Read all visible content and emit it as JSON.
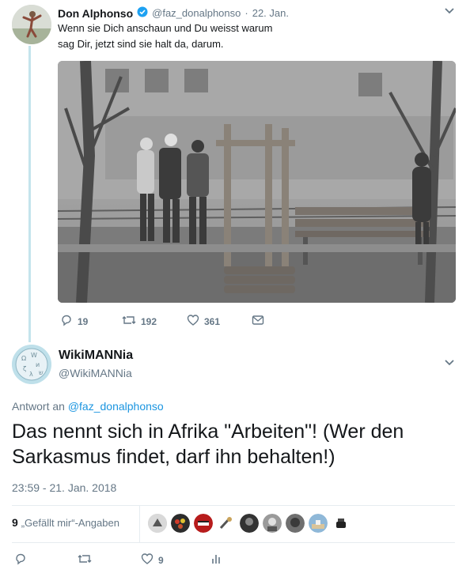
{
  "quoted_tweet": {
    "display_name": "Don Alphonso",
    "handle": "@faz_donalphonso",
    "separator": "·",
    "date": "22. Jan.",
    "text_line1": "Wenn sie Dich anschaun und Du weisst warum",
    "text_line2": "sag Dir, jetzt sind sie halt da, darum.",
    "replies": "19",
    "retweets": "192",
    "likes": "361",
    "verified_color": "#1da1f2"
  },
  "main_tweet": {
    "display_name": "WikiMANNia",
    "handle": "@WikiMANNia",
    "reply_prefix": "Antwort an",
    "reply_to": "@faz_donalphonso",
    "text_line1": "Das nennt sich in Afrika \"Arbeiten\"! (Wer den",
    "text_line2": "Sarkasmus findet, darf ihn behalten!)",
    "timestamp": "23:59 - 21. Jan. 2018",
    "likes_count": "9",
    "likes_label": "„Gefällt mir“-Angaben",
    "action_likes": "9"
  },
  "colors": {
    "link": "#1b95e0",
    "muted": "#657786",
    "thread_line": "#c4e4ec"
  },
  "icons": [
    "reply-icon",
    "retweet-icon",
    "like-icon",
    "message-icon",
    "analytics-icon",
    "chevron-down-icon",
    "verified-icon"
  ]
}
